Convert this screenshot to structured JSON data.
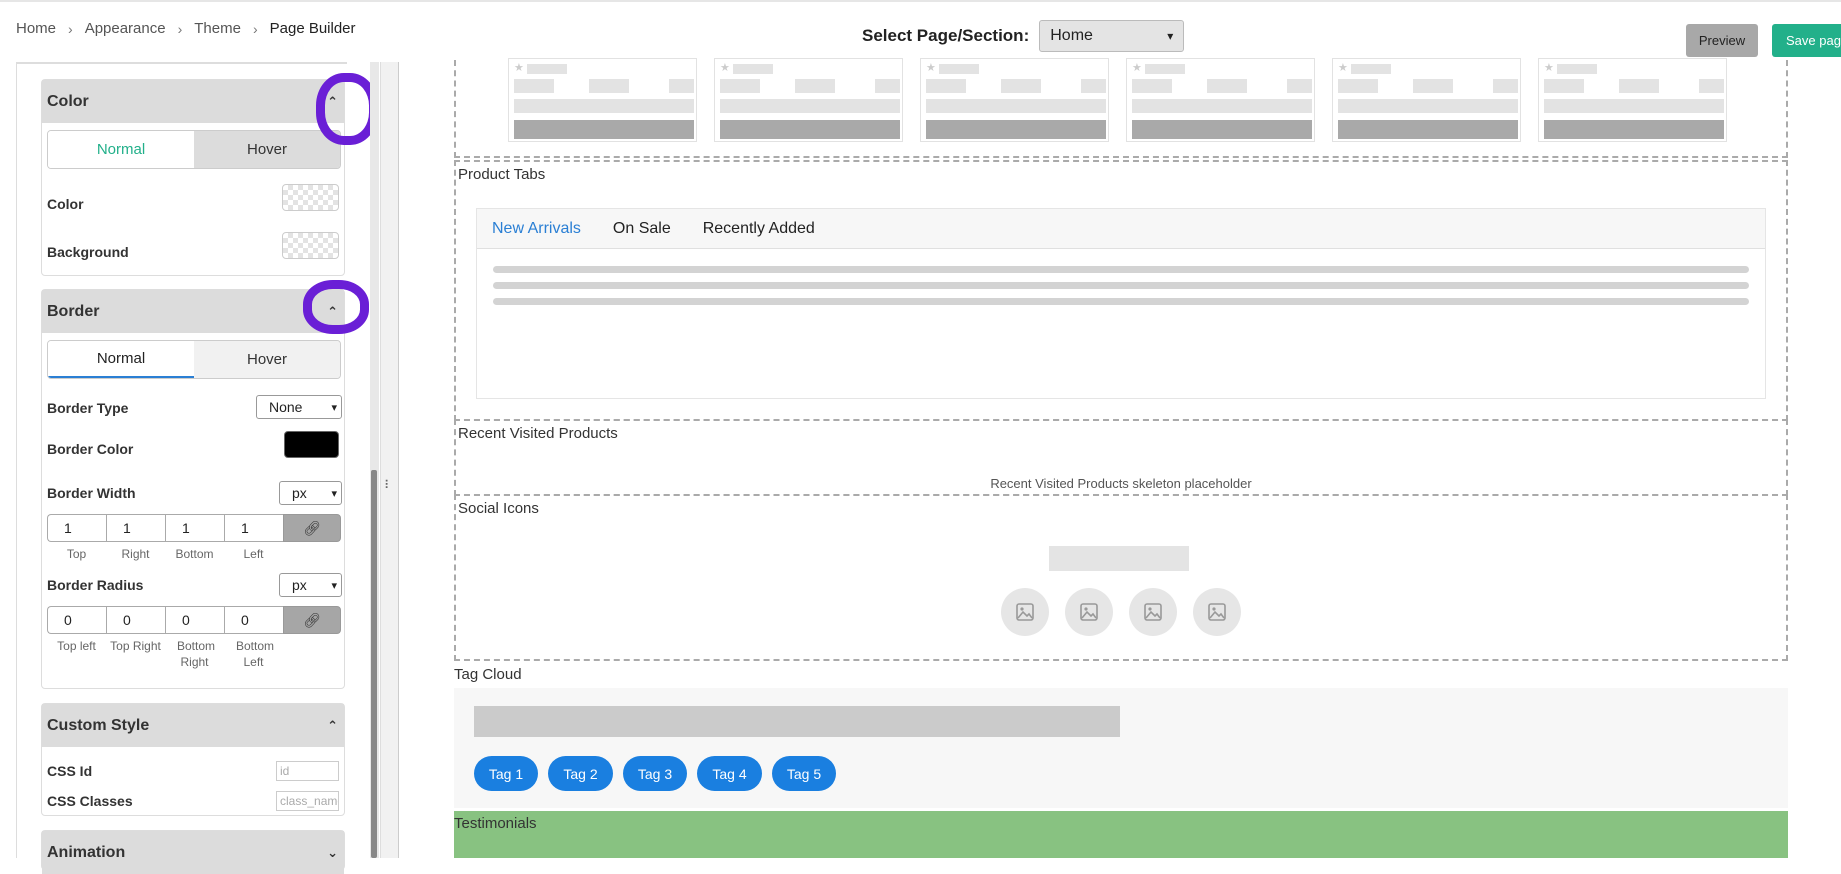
{
  "breadcrumb": {
    "items": [
      "Home",
      "Appearance",
      "Theme",
      "Page Builder"
    ]
  },
  "header": {
    "select_label": "Select Page/Section:",
    "selected_page": "Home",
    "preview_label": "Preview",
    "save_label": "Save page"
  },
  "sidebar": {
    "color_panel": {
      "title": "Color",
      "tabs": [
        "Normal",
        "Hover"
      ],
      "color_label": "Color",
      "background_label": "Background"
    },
    "border_panel": {
      "title": "Border",
      "tabs": [
        "Normal",
        "Hover"
      ],
      "type_label": "Border Type",
      "type_value": "None",
      "color_label": "Border Color",
      "color_value": "#000000",
      "width_label": "Border Width",
      "width_unit": "px",
      "width_values": [
        "1",
        "1",
        "1",
        "1"
      ],
      "width_sublabels": [
        "Top",
        "Right",
        "Bottom",
        "Left"
      ],
      "radius_label": "Border Radius",
      "radius_unit": "px",
      "radius_values": [
        "0",
        "0",
        "0",
        "0"
      ],
      "radius_sublabels": [
        "Top left",
        "Top Right",
        "Bottom Right",
        "Bottom Left"
      ]
    },
    "custom_style_panel": {
      "title": "Custom Style",
      "css_id_label": "CSS Id",
      "css_id_placeholder": "id",
      "css_classes_label": "CSS Classes",
      "css_classes_placeholder": "class_name"
    },
    "animation_panel": {
      "title": "Animation"
    }
  },
  "canvas": {
    "product_tabs": {
      "title": "Product Tabs",
      "tabs": [
        "New Arrivals",
        "On Sale",
        "Recently Added"
      ]
    },
    "recent_visited": {
      "title": "Recent Visited Products",
      "placeholder": "Recent Visited Products skeleton placeholder"
    },
    "social_icons": {
      "title": "Social Icons"
    },
    "tag_cloud": {
      "title": "Tag Cloud",
      "tags": [
        "Tag 1",
        "Tag 2",
        "Tag 3",
        "Tag 4",
        "Tag 5"
      ]
    },
    "testimonials": {
      "title": "Testimonials"
    }
  },
  "colors": {
    "accent_green": "#22b08a",
    "tab_active_blue": "#2a7fd4",
    "tag_blue": "#1a7fe0",
    "annotation_purple": "#6a1fd6",
    "testimonials_green": "#88c281"
  },
  "icons": {
    "chevron_up": "chevron-up-icon",
    "chevron_down": "chevron-down-icon",
    "link": "link-icon",
    "star": "star-icon",
    "image": "image-icon"
  }
}
